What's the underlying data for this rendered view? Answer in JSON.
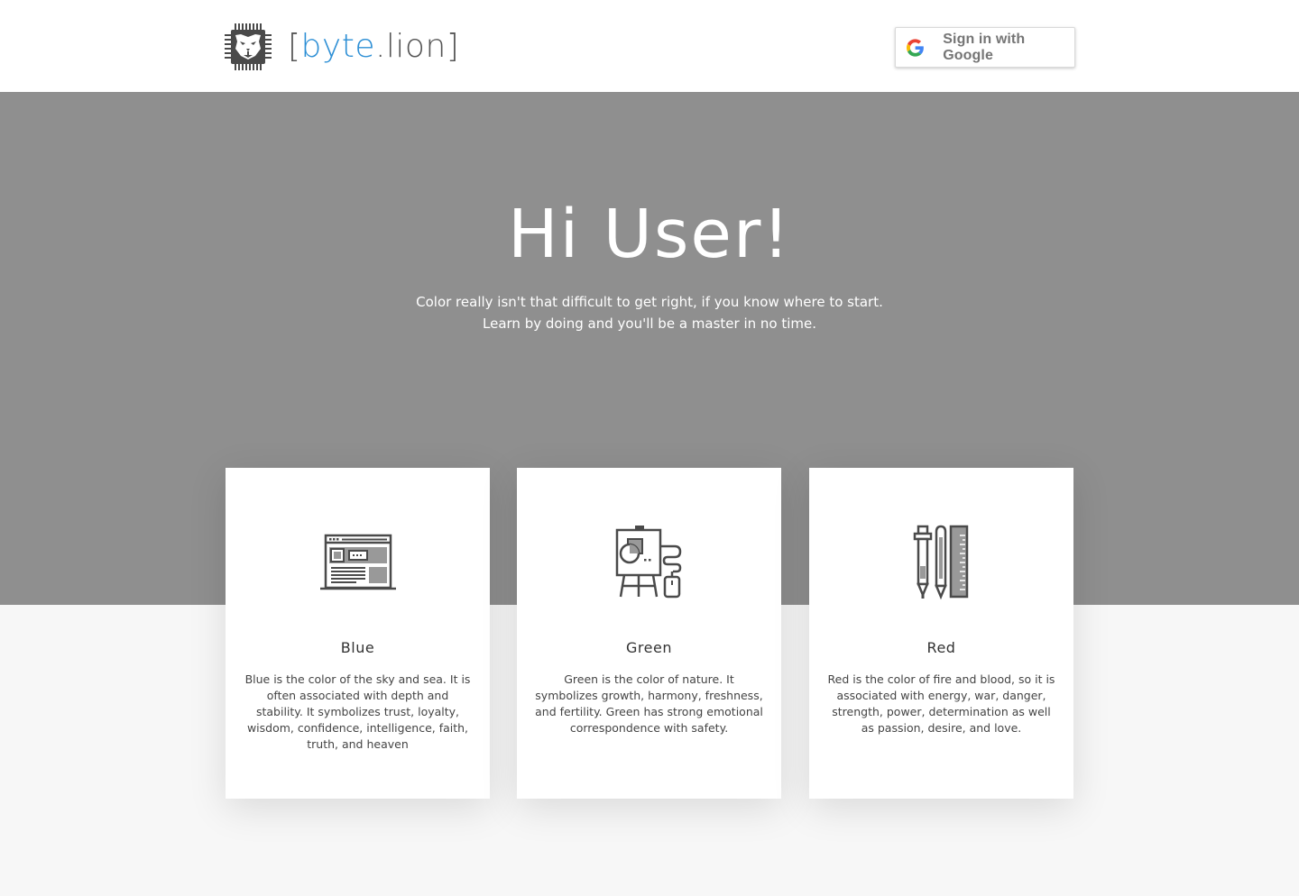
{
  "header": {
    "logo": {
      "text_open": "[",
      "text_byte": "byte",
      "text_dot_lion": ".lion",
      "text_close": "]",
      "accent_color": "#2d8fd5"
    },
    "signin": {
      "label": "Sign in with Google",
      "icon": "google-icon"
    }
  },
  "hero": {
    "title": "Hi User!",
    "subtitle_line1": "Color really isn't that difficult to get right, if you know where to start.",
    "subtitle_line2": "Learn by doing and you'll be a master in no time.",
    "background_color": "#8f8f8f"
  },
  "cards": [
    {
      "icon": "browser-layout-icon",
      "title": "Blue",
      "text": "Blue is the color of the sky and sea. It is often associated with depth and stability. It symbolizes trust, loyalty, wisdom, confidence, intelligence, faith, truth, and heaven"
    },
    {
      "icon": "easel-presentation-icon",
      "title": "Green",
      "text": "Green is the color of nature. It symbolizes growth, harmony, freshness, and fertility. Green has strong emotional correspondence with safety."
    },
    {
      "icon": "pens-ruler-icon",
      "title": "Red",
      "text": "Red is the color of fire and blood, so it is associated with energy, war, danger, strength, power, determination as well as passion, desire, and love."
    }
  ]
}
